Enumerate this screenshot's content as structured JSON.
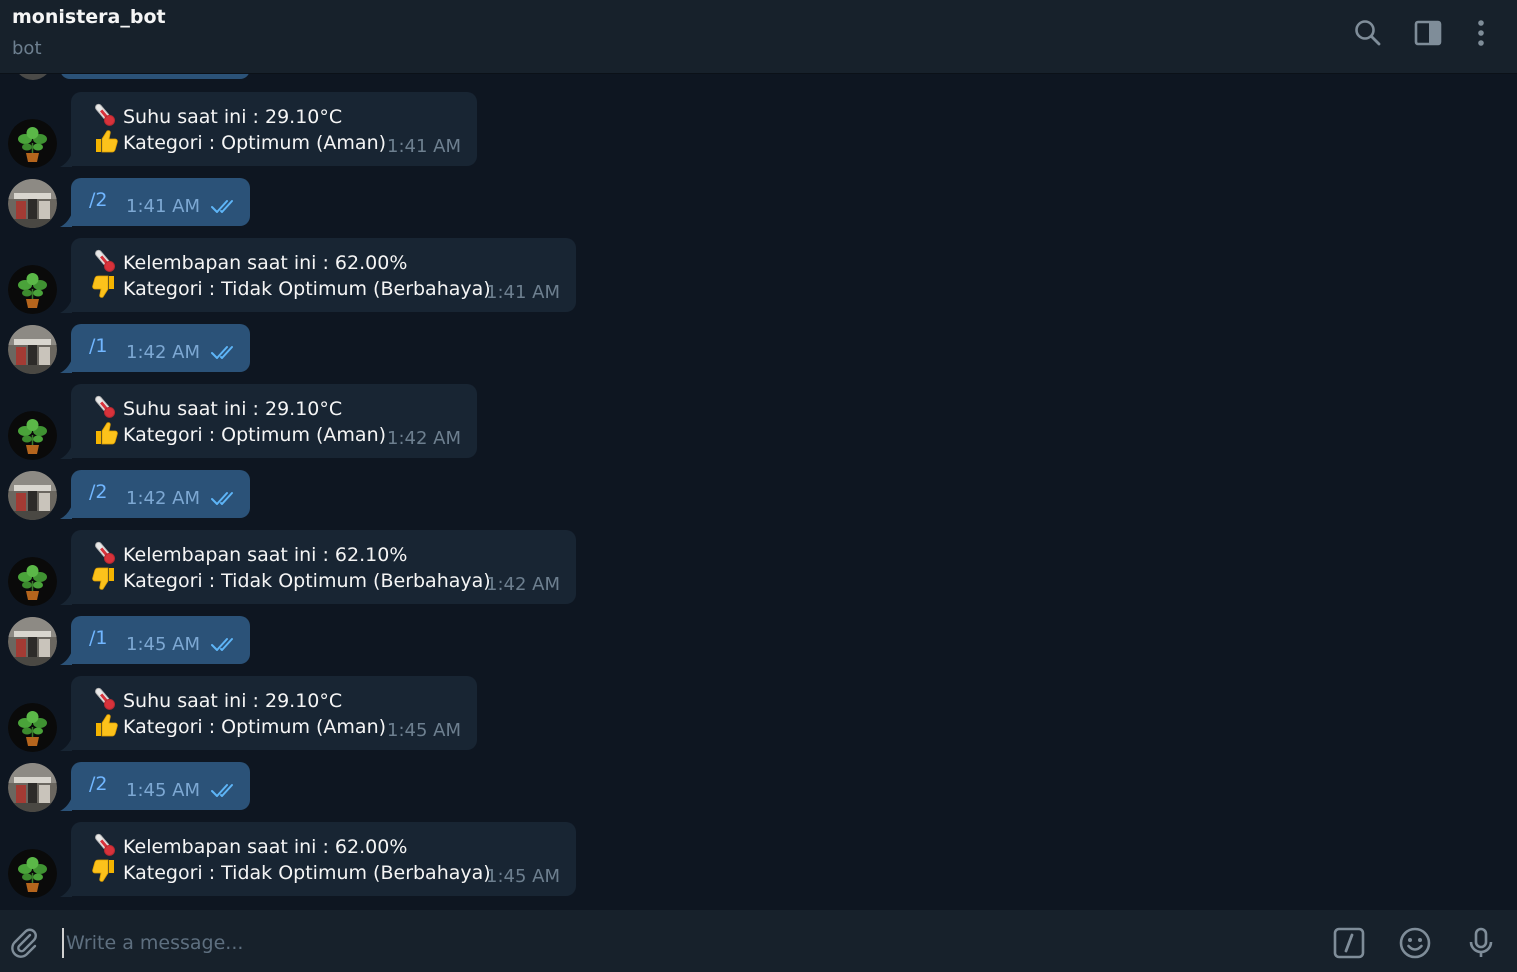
{
  "header": {
    "title": "monistera_bot",
    "status": "bot"
  },
  "icons": {
    "search": "search-icon",
    "sidebar": "sidebar-toggle-icon",
    "more": "more-vertical-icon",
    "attach": "paperclip-icon",
    "commands": "bot-commands-icon",
    "emoji": "emoji-icon",
    "mic": "microphone-icon",
    "temp": "thermometer-emoji",
    "up": "thumbs-up-emoji",
    "down": "thumbs-down-emoji"
  },
  "colors": {
    "background": "#0e1621",
    "panel": "#17212b",
    "incoming_bubble": "#182533",
    "outgoing_bubble": "#2b5278",
    "command_text": "#71b6ff",
    "read_ticks": "#5eb5f7"
  },
  "messages": [
    {
      "dir": "in",
      "line1": "Suhu saat ini : 29.10°C",
      "line2": "Kategori : Optimum (Aman)",
      "time": "1:41 AM",
      "verdict": "up"
    },
    {
      "dir": "out",
      "text": "/2",
      "time": "1:41 AM",
      "read": true
    },
    {
      "dir": "in",
      "line1": "Kelembapan saat ini : 62.00%",
      "line2": "Kategori : Tidak Optimum (Berbahaya)",
      "time": "1:41 AM",
      "verdict": "down"
    },
    {
      "dir": "out",
      "text": "/1",
      "time": "1:42 AM",
      "read": true
    },
    {
      "dir": "in",
      "line1": "Suhu saat ini : 29.10°C",
      "line2": "Kategori : Optimum (Aman)",
      "time": "1:42 AM",
      "verdict": "up"
    },
    {
      "dir": "out",
      "text": "/2",
      "time": "1:42 AM",
      "read": true
    },
    {
      "dir": "in",
      "line1": "Kelembapan saat ini : 62.10%",
      "line2": "Kategori : Tidak Optimum (Berbahaya)",
      "time": "1:42 AM",
      "verdict": "down"
    },
    {
      "dir": "out",
      "text": "/1",
      "time": "1:45 AM",
      "read": true
    },
    {
      "dir": "in",
      "line1": "Suhu saat ini : 29.10°C",
      "line2": "Kategori : Optimum (Aman)",
      "time": "1:45 AM",
      "verdict": "up"
    },
    {
      "dir": "out",
      "text": "/2",
      "time": "1:45 AM",
      "read": true
    },
    {
      "dir": "in",
      "line1": "Kelembapan saat ini : 62.00%",
      "line2": "Kategori : Tidak Optimum (Berbahaya)",
      "time": "1:45 AM",
      "verdict": "down"
    }
  ],
  "composer": {
    "placeholder": "Write a message..."
  }
}
